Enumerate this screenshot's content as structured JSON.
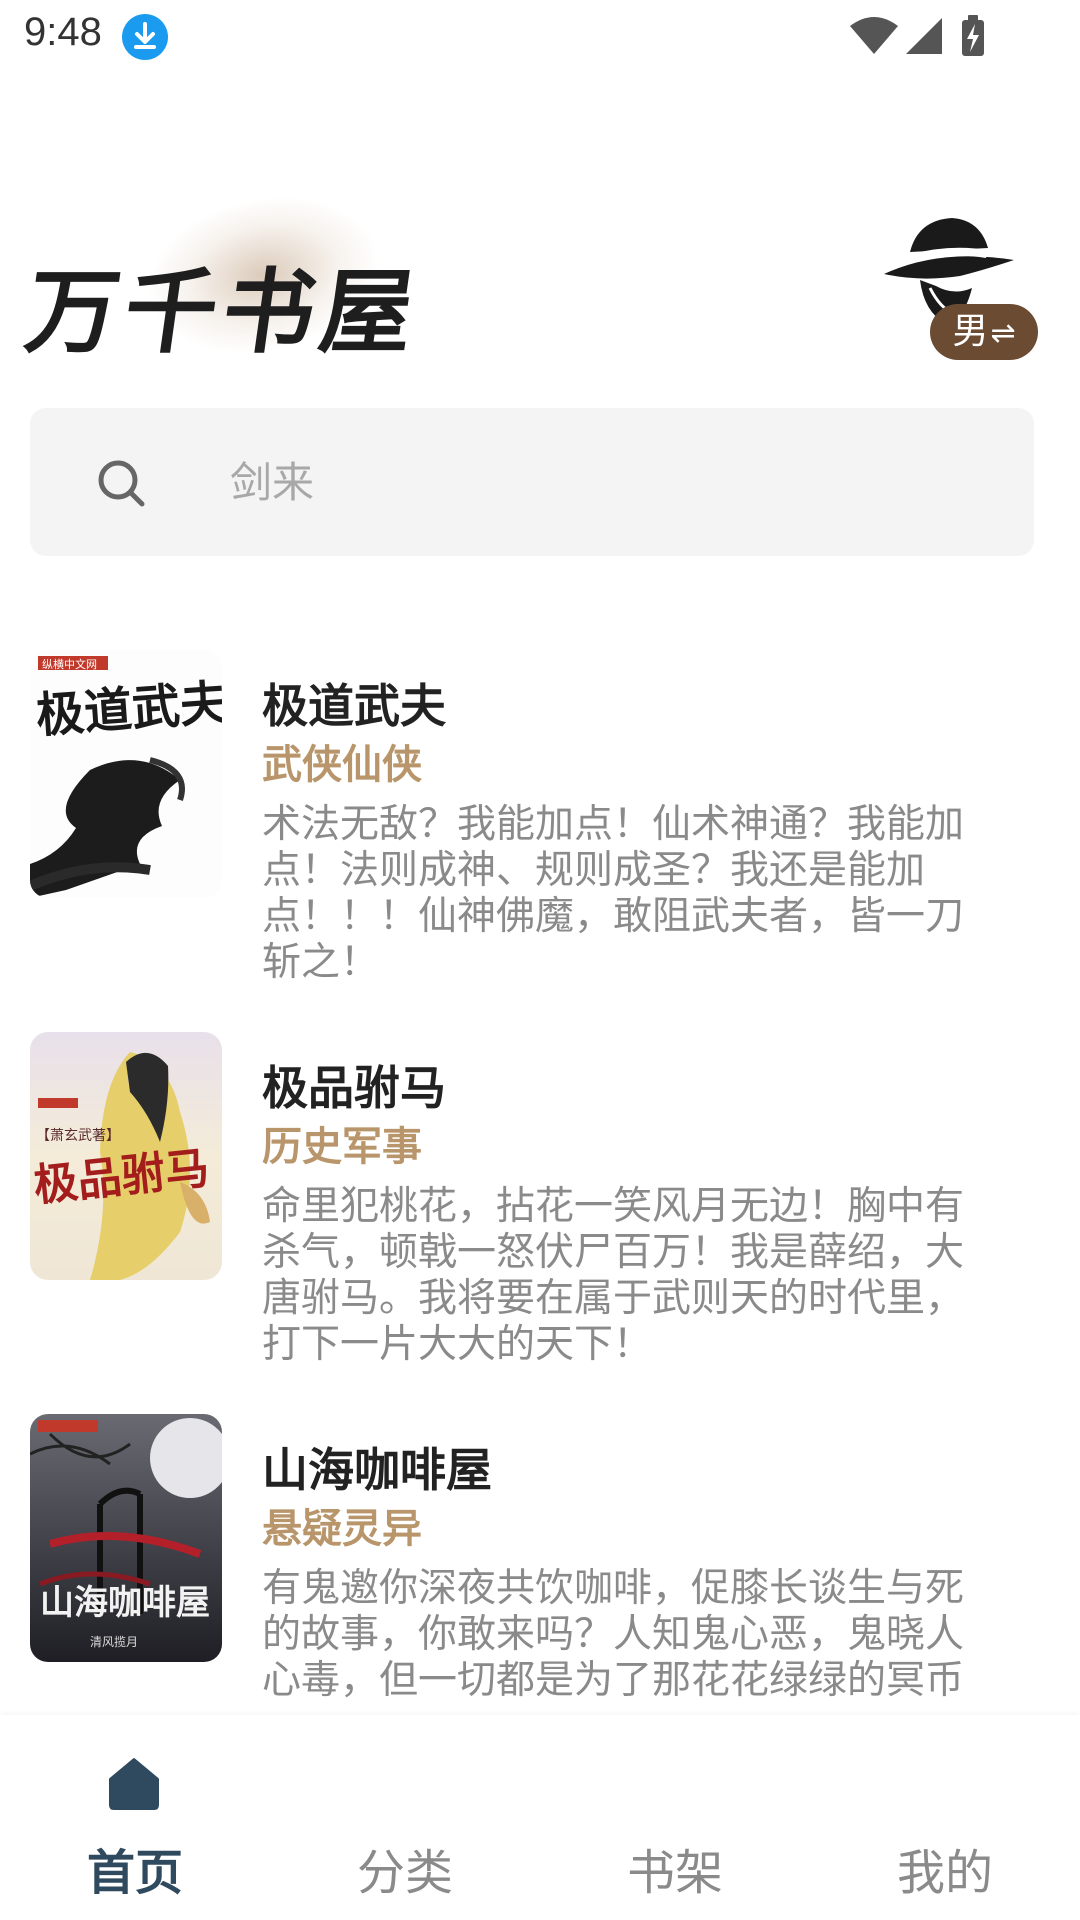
{
  "status_bar": {
    "time": "9:48",
    "icons": [
      "download-icon",
      "wifi-icon",
      "signal-icon",
      "battery-charging-icon"
    ]
  },
  "header": {
    "brand_title": "万千书屋",
    "avatar_icon": "detective-hat-icon",
    "gender_toggle_label": "男",
    "gender_toggle_icon": "⇌"
  },
  "search": {
    "placeholder": "剑来",
    "icon": "search-icon"
  },
  "books": [
    {
      "title": "极道武夫",
      "category": "武侠仙侠",
      "description": "术法无敌？我能加点！仙术神通？我能加点！法则成神、规则成圣？我还是能加点！！！仙神佛魔，敢阻武夫者，皆一刀斩之！"
    },
    {
      "title": "极品驸马",
      "category": "历史军事",
      "description": "命里犯桃花，拈花一笑风月无边！胸中有杀气，顿戟一怒伏尸百万！我是薛绍，大唐驸马。我将要在属于武则天的时代里，打下一片大大的天下！"
    },
    {
      "title": "山海咖啡屋",
      "category": "悬疑灵异",
      "description": "有鬼邀你深夜共饮咖啡，促膝长谈生与死的故事，你敢来吗？人知鬼心恶，鬼晓人心毒，但一切都是为了那花花绿绿的冥币"
    }
  ],
  "bottom_nav": {
    "items": [
      {
        "label": "首页",
        "icon": "home-icon",
        "active": true
      },
      {
        "label": "分类",
        "active": false
      },
      {
        "label": "书架",
        "active": false
      },
      {
        "label": "我的",
        "active": false
      }
    ]
  },
  "colors": {
    "category": "#b8956a",
    "toggle_bg": "#6b4b32",
    "nav_active": "#2f4a5e",
    "search_bg": "#f4f4f4"
  }
}
